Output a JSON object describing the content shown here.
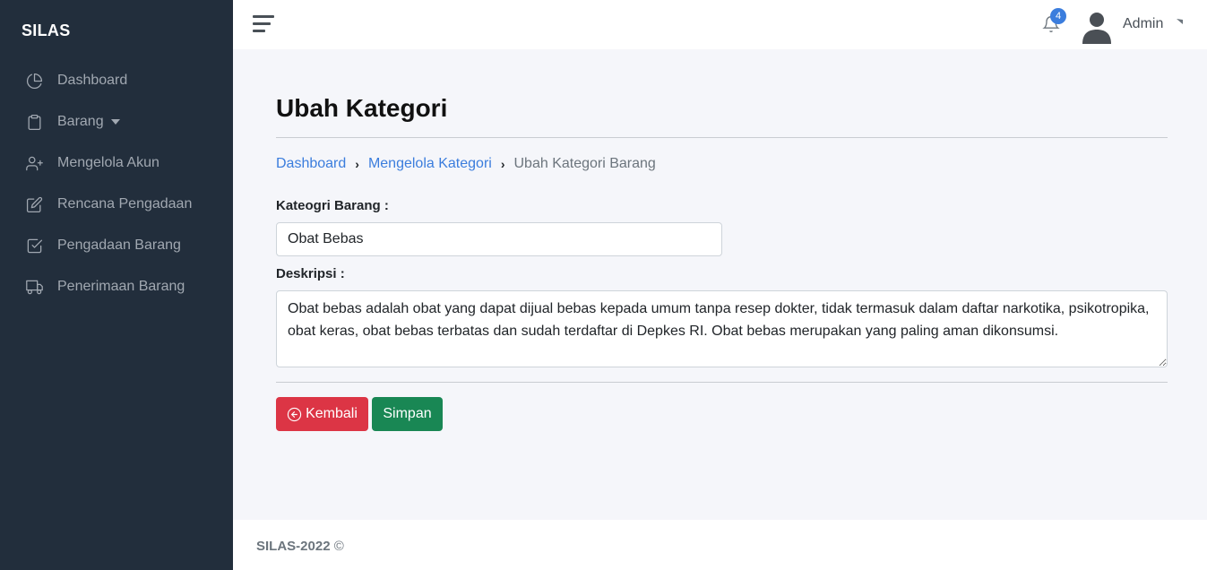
{
  "sidebar": {
    "brand": "SILAS",
    "items": [
      {
        "label": "Dashboard",
        "icon": "pie-chart-icon"
      },
      {
        "label": "Barang",
        "icon": "clipboard-icon"
      },
      {
        "label": "Mengelola Akun",
        "icon": "user-plus-icon"
      },
      {
        "label": "Rencana Pengadaan",
        "icon": "edit-icon"
      },
      {
        "label": "Pengadaan Barang",
        "icon": "check-square-icon"
      },
      {
        "label": "Penerimaan Barang",
        "icon": "truck-icon"
      }
    ]
  },
  "topbar": {
    "notification_count": "4",
    "user_name": "Admin"
  },
  "page": {
    "title": "Ubah Kategori",
    "breadcrumb": [
      "Dashboard",
      "Mengelola Kategori",
      "Ubah Kategori Barang"
    ],
    "category_label": "Kateogri Barang :",
    "category_value": "Obat Bebas",
    "description_label": "Deskripsi :",
    "description_value": "Obat bebas adalah obat yang dapat dijual bebas kepada umum tanpa resep dokter, tidak termasuk dalam daftar narkotika, psikotropika, obat keras, obat bebas terbatas dan sudah terdaftar di Depkes RI. Obat bebas merupakan yang paling aman dikonsumsi.",
    "back_button": "Kembali",
    "save_button": "Simpan"
  },
  "footer": {
    "brand": "SILAS-2022",
    "symbol": "©"
  },
  "colors": {
    "sidebar_bg": "#222e3c",
    "link": "#3b7ddd",
    "danger": "#dc3545",
    "success": "#198754"
  }
}
